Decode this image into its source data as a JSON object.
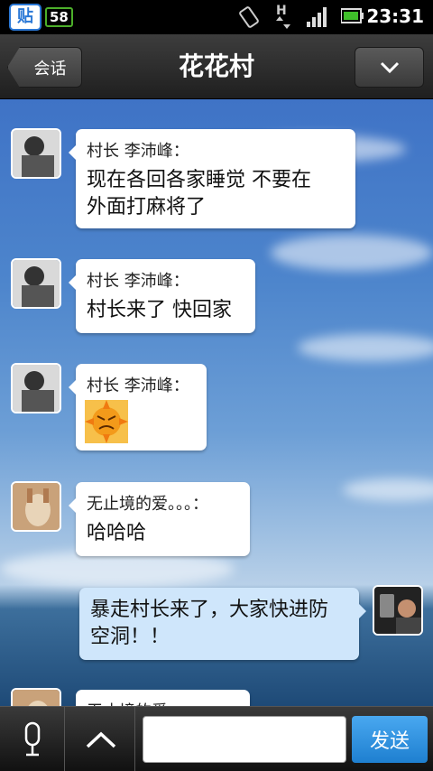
{
  "status_bar": {
    "notification_icons": [
      "tieba-icon",
      "58-icon"
    ],
    "tieba_label": "贴",
    "app58_label": "58",
    "network_label": "H",
    "time": "23:31"
  },
  "header": {
    "back_label": "会话",
    "title": "花花村",
    "menu_icon": "chevron-down-icon"
  },
  "messages": [
    {
      "sender": "村长  李沛峰：",
      "text": "现在各回各家睡觉  不要在\n外面打麻将了",
      "type": "text",
      "direction": "received"
    },
    {
      "sender": "村长  李沛峰：",
      "text": "村长来了  快回家",
      "type": "text",
      "direction": "received"
    },
    {
      "sender": "村长  李沛峰：",
      "text": "",
      "type": "emoji",
      "emoji_icon": "angry-sun-emoji-icon",
      "direction": "received"
    },
    {
      "sender": "无止境的爱。。。：",
      "text": "哈哈哈",
      "type": "text",
      "direction": "received"
    },
    {
      "sender": "",
      "text": "暴走村长来了，大家快进防\n空洞！！",
      "type": "text",
      "direction": "sent"
    },
    {
      "sender": "无止境的爱",
      "text": "",
      "type": "partial",
      "direction": "received"
    }
  ],
  "bottom_bar": {
    "mic_icon": "microphone-icon",
    "expand_icon": "chevron-up-icon",
    "input_value": "",
    "send_label": "发送"
  },
  "colors": {
    "send_button": "#1e7fd0",
    "sent_bubble": "#cfe6fb"
  }
}
